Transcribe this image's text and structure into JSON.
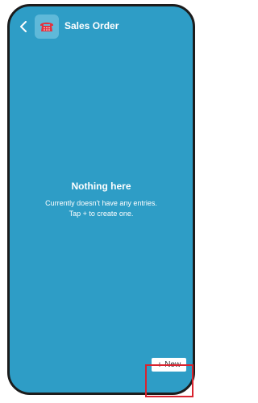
{
  "header": {
    "title": "Sales Order",
    "back_icon": "chevron-left-icon",
    "app_icon": "phone-icon",
    "app_icon_color": "#e2323f"
  },
  "empty_state": {
    "title": "Nothing here",
    "line1": "Currently doesn't have any entries.",
    "line2": "Tap + to create one."
  },
  "fab": {
    "icon": "+",
    "label": "New"
  },
  "colors": {
    "background": "#2e9dc6",
    "highlight": "#d8242f"
  }
}
